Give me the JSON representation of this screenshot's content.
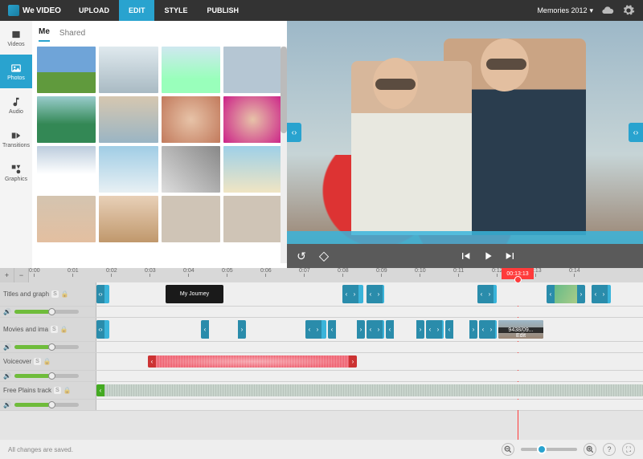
{
  "brand": {
    "we": "We",
    "video": "VIDEO"
  },
  "nav": {
    "upload": "UPLOAD",
    "edit": "EDIT",
    "style": "STYLE",
    "publish": "PUBLISH"
  },
  "project": {
    "name": "Memories 2012",
    "caret": "▾"
  },
  "sidebar": {
    "items": [
      {
        "label": "Videos"
      },
      {
        "label": "Photos"
      },
      {
        "label": "Audio"
      },
      {
        "label": "Transitions"
      },
      {
        "label": "Graphics"
      }
    ]
  },
  "library": {
    "tabs": {
      "me": "Me",
      "shared": "Shared"
    }
  },
  "thumbs": {
    "count": 16
  },
  "preview": {
    "diamond": "◇"
  },
  "ruler": {
    "ticks": [
      "0:00",
      "0:01",
      "0:02",
      "0:03",
      "0:04",
      "0:05",
      "0:06",
      "0:07",
      "0:08",
      "0:09",
      "0:10",
      "0:11",
      "0:12",
      "0:13",
      "0:14"
    ]
  },
  "playhead": {
    "time": "00:13:13"
  },
  "tracks": {
    "titles": {
      "name": "Titles and graph",
      "s": "S",
      "clip_title": "My Journey",
      "edit": "Edit"
    },
    "movies": {
      "name": "Movies and ima",
      "s": "S"
    },
    "voice": {
      "name": "Voiceover",
      "s": "S"
    },
    "music": {
      "name": "Free Plains track",
      "s": "S"
    }
  },
  "status": {
    "saved": "All changes are saved."
  },
  "glyph": {
    "plus": "+",
    "minus": "−",
    "mag_in": "⊕",
    "mag_out": "⊖",
    "help": "?",
    "full": "⛶",
    "speaker": "🔊",
    "lock": "🔒",
    "diamond": "◇",
    "handle": "‹›",
    "undo": "↺"
  }
}
